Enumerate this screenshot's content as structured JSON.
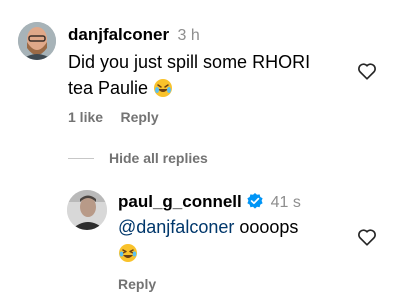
{
  "comment1": {
    "username": "danjfalconer",
    "time": "3 h",
    "text_line1": "Did you just spill some RHORI",
    "text_line2": "tea Paulie",
    "emoji": "rolling-on-floor-laughing",
    "likes": "1 like",
    "reply_label": "Reply"
  },
  "replies_toggle": {
    "label": "Hide all replies"
  },
  "reply1": {
    "username": "paul_g_connell",
    "time": "41 s",
    "mention": "@danjfalconer",
    "text_rest": "oooops",
    "emoji": "grinning-squinting-face-with-tears",
    "verified_color": "#0095f6",
    "reply_label": "Reply"
  },
  "colors": {
    "meta_gray": "#737373",
    "time_gray": "#8e8e8e",
    "mention_blue": "#00376b",
    "divider": "#c7c7c7"
  }
}
